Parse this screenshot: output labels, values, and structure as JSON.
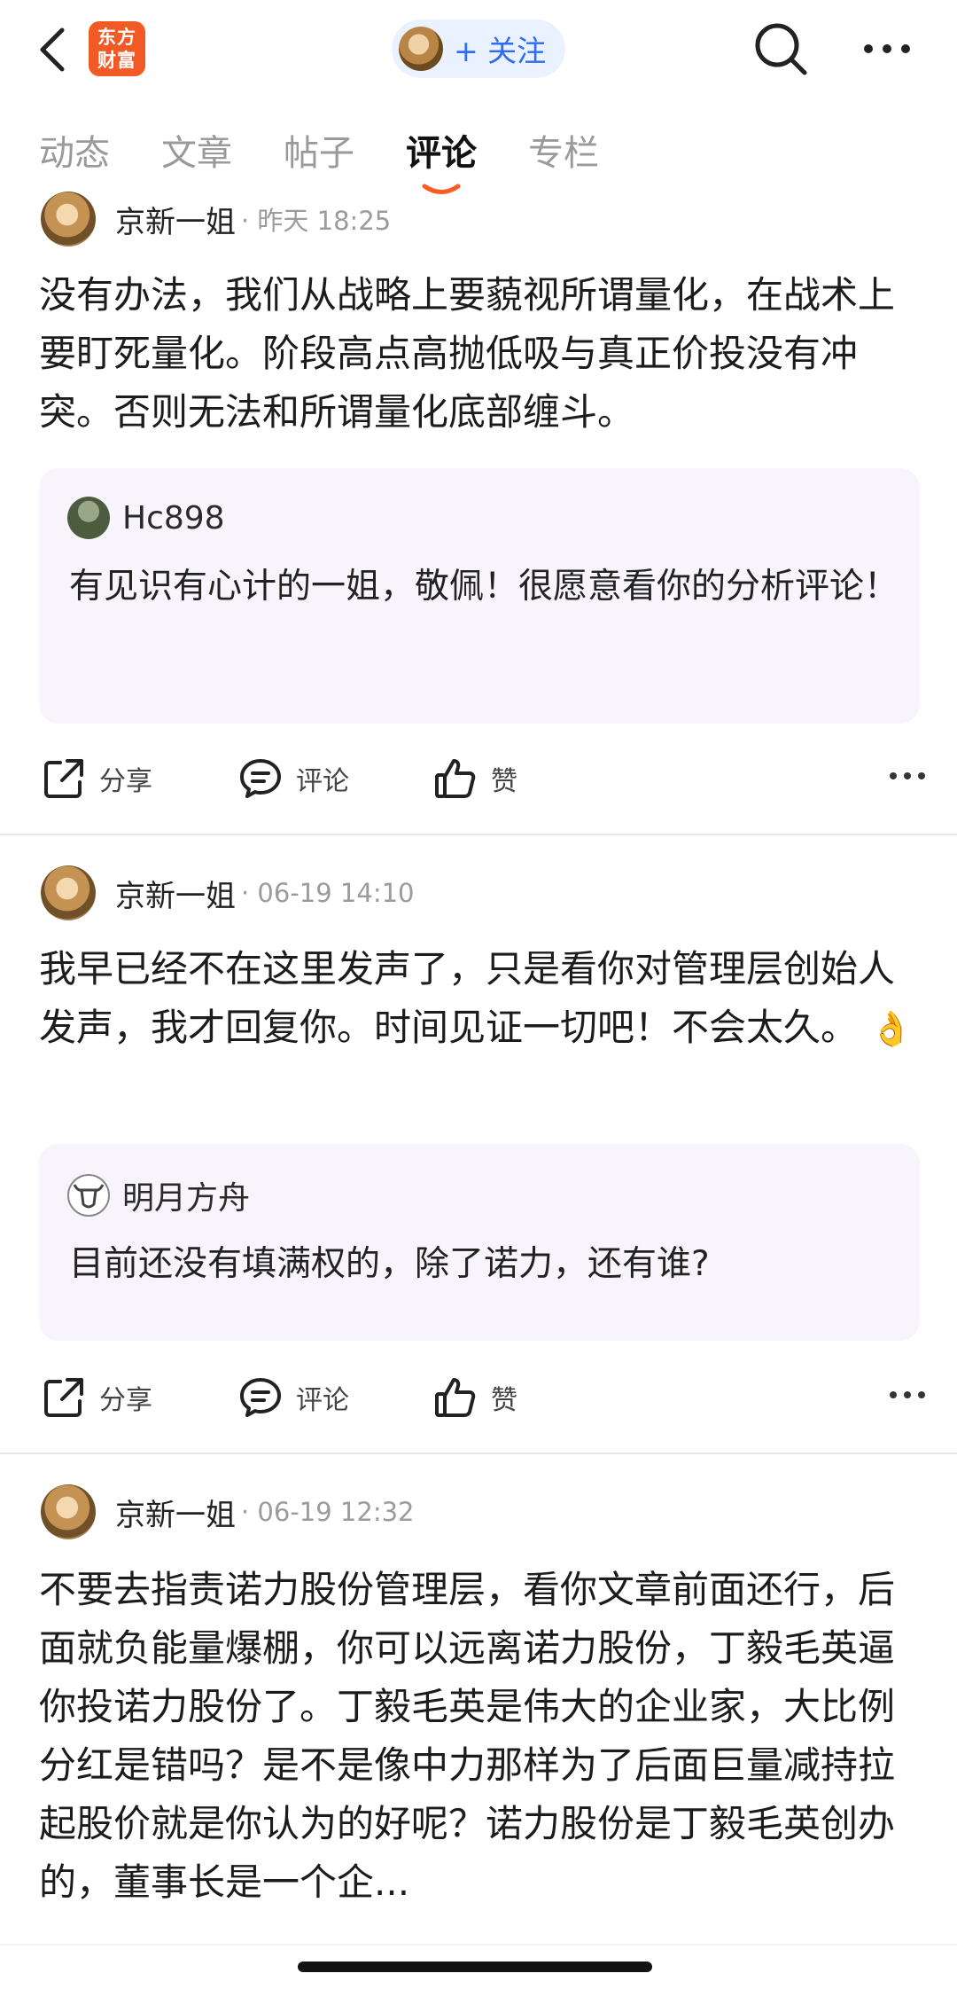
{
  "topbar": {
    "logo_text": "东方财富",
    "follow_label": "+ 关注"
  },
  "tabs": [
    "动态",
    "文章",
    "帖子",
    "评论",
    "专栏"
  ],
  "active_tab_index": 3,
  "colors": {
    "accent_orange": "#f15a24",
    "follow_blue": "#2f6cf6",
    "indicator": "#ff5a1f"
  },
  "posts": [
    {
      "author": "京新一姐",
      "meta": "· 昨天 18:25",
      "text": "没有办法，我们从战略上要藐视所谓量化，在战术上要盯死量化。阶段高点高抛低吸与真正价投没有冲突。否则无法和所谓量化底部缠斗。",
      "quote": {
        "author": "Hc898",
        "avatar": "green-landscape-avatar",
        "text": "有见识有心计的一姐，敬佩！很愿意看你的分析评论！"
      },
      "actions": {
        "share": "分享",
        "comment": "评论",
        "like": "赞"
      }
    },
    {
      "author": "京新一姐",
      "meta": "· 06-19 14:10",
      "text": "我早已经不在这里发声了，只是看你对管理层创始人发声，我才回复你。时间见证一切吧！不会太久。",
      "emoji": "👌",
      "quote": {
        "author": "明月方舟",
        "avatar": "bull-avatar",
        "text": "目前还没有填满权的，除了诺力，还有谁?"
      },
      "actions": {
        "share": "分享",
        "comment": "评论",
        "like": "赞"
      }
    },
    {
      "author": "京新一姐",
      "meta": "· 06-19 12:32",
      "text": "不要去指责诺力股份管理层，看你文章前面还行，后面就负能量爆棚，你可以远离诺力股份，丁毅毛英逼你投诺力股份了。丁毅毛英是伟大的企业家，大比例分红是错吗？是不是像中力那样为了后面巨量减持拉起股价就是你认为的好呢？诺力股份是丁毅毛英创办的，董事长是一个企..."
    }
  ]
}
